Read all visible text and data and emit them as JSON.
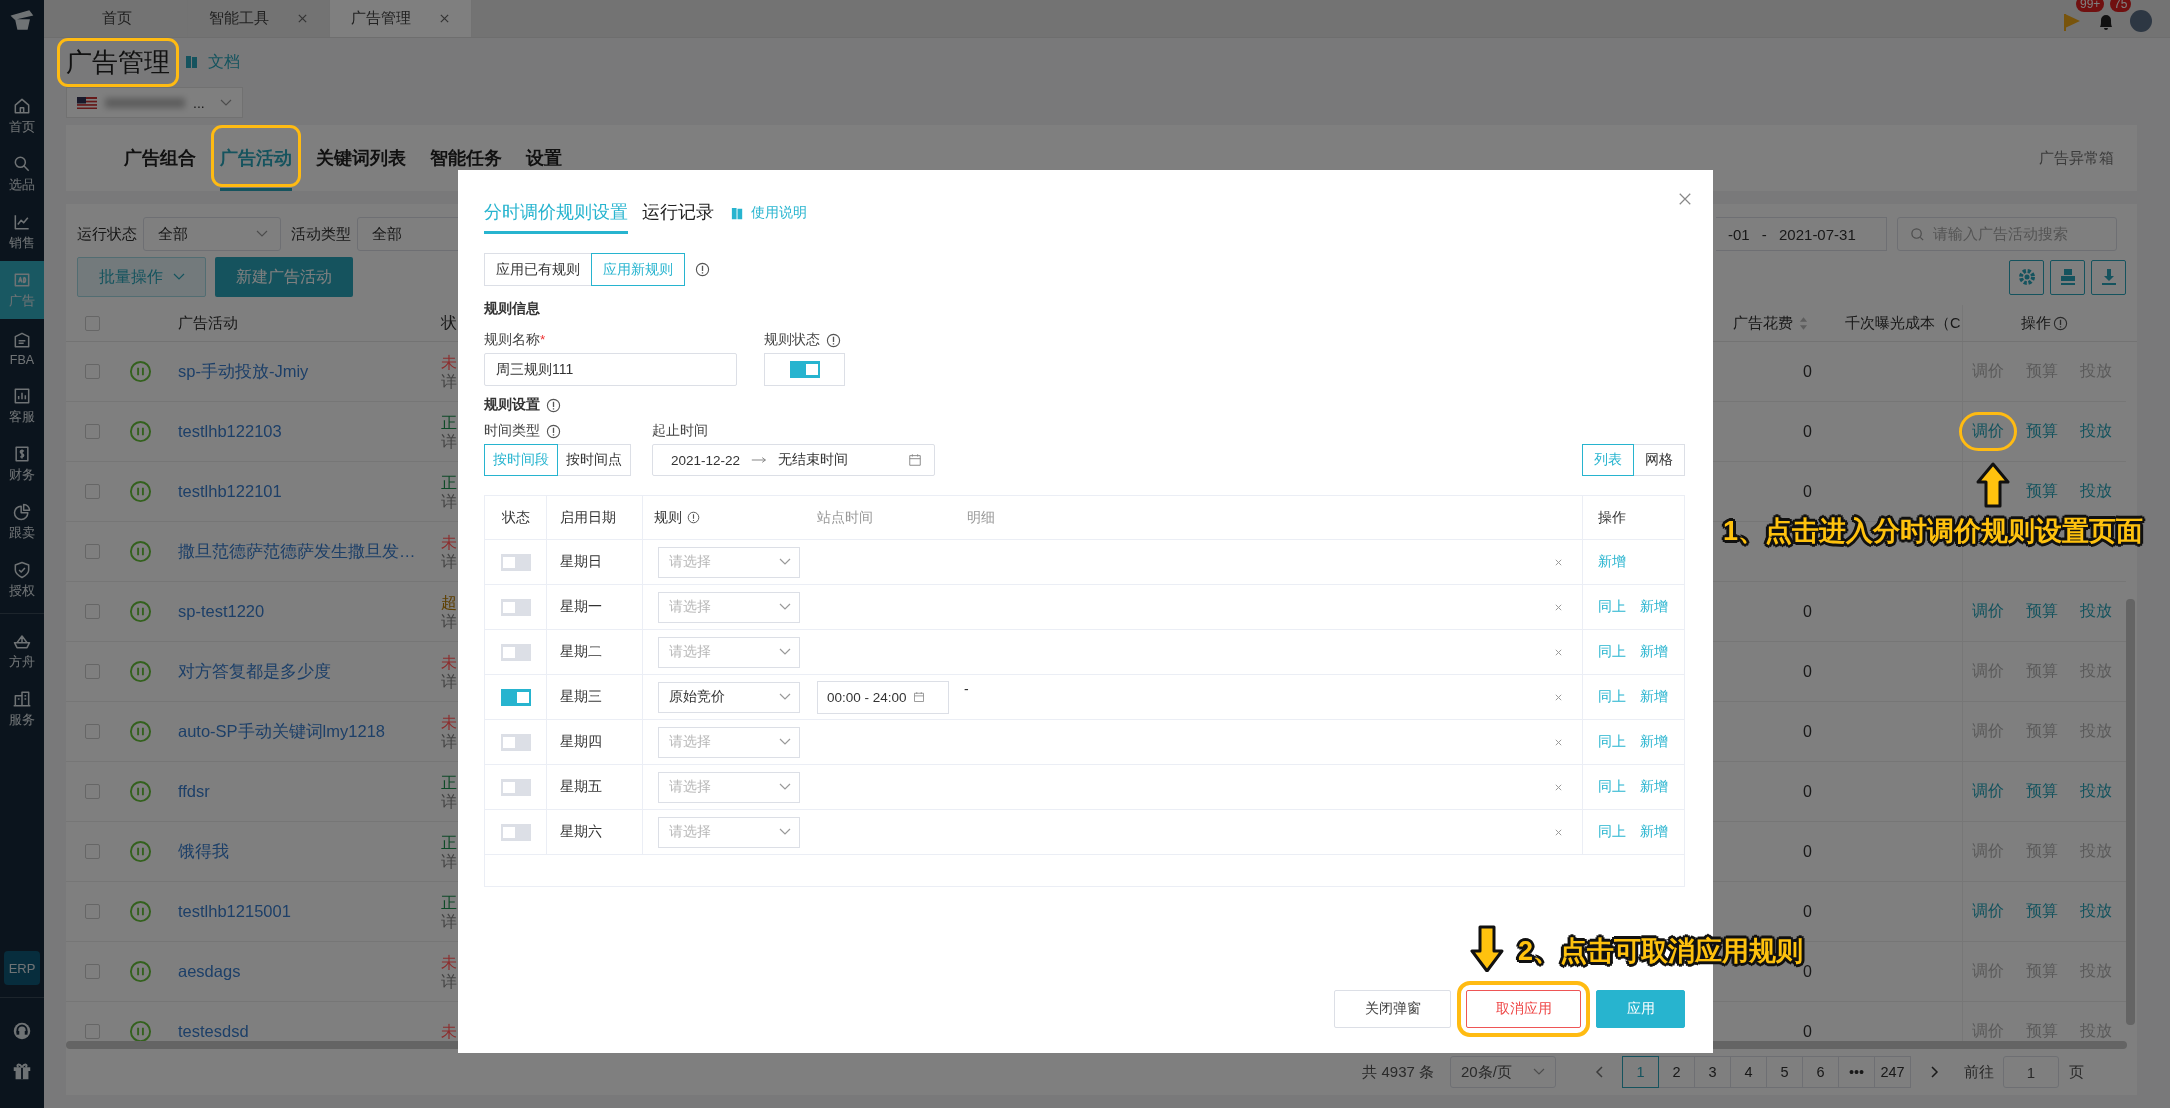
{
  "top_bar": {
    "tabs": [
      {
        "label": "首页",
        "closable": false,
        "selected": false
      },
      {
        "label": "智能工具",
        "closable": true,
        "selected": false
      },
      {
        "label": "广告管理",
        "closable": true,
        "selected": true
      }
    ],
    "flag_badge": "99+",
    "bell_badge": "75"
  },
  "sidebar": {
    "main": [
      {
        "label": "首页",
        "selected": false
      },
      {
        "label": "选品",
        "selected": false
      },
      {
        "label": "销售",
        "selected": false
      },
      {
        "label": "广告",
        "selected": true
      },
      {
        "label": "FBA",
        "selected": false
      },
      {
        "label": "客服",
        "selected": false
      },
      {
        "label": "财务",
        "selected": false
      },
      {
        "label": "跟卖",
        "selected": false
      },
      {
        "label": "授权",
        "selected": false
      }
    ],
    "more": [
      {
        "label": "方舟",
        "selected": false
      },
      {
        "label": "服务",
        "selected": false
      }
    ],
    "badge": "ERP"
  },
  "page": {
    "title": {
      "text": "广告管理",
      "highlighted": true
    },
    "doc_link": "文档",
    "store": {
      "text": "..."
    },
    "nav_tabs": [
      {
        "label": "广告组合",
        "selected": false,
        "highlighted": false
      },
      {
        "label": "广告活动",
        "selected": true,
        "highlighted": true
      },
      {
        "label": "关键词列表",
        "selected": false,
        "highlighted": false
      },
      {
        "label": "智能任务",
        "selected": false,
        "highlighted": false
      },
      {
        "label": "设置",
        "selected": false,
        "highlighted": false
      }
    ],
    "exception_box": "广告异常箱"
  },
  "filters": {
    "fields": [
      {
        "label": "运行状态",
        "value": "全部"
      },
      {
        "label": "活动类型",
        "value": "全部"
      }
    ],
    "date_range": "-01 - 2021-07-31",
    "search_placeholder": "请输入广告活动搜索",
    "batch_button": "批量操作",
    "create_button": "新建广告活动"
  },
  "campaigns": {
    "columns": {
      "name": "广告活动",
      "status": "状",
      "spend": "广告花费",
      "cpm": "千次曝光成本（C",
      "actions": "操作"
    },
    "all_checked": false,
    "rows": [
      {
        "name": "sp-手动投放-Jmiy",
        "checked": false,
        "status": {
          "text": "未",
          "color": "#8c2d2d"
        },
        "detail": "详",
        "spend": "0",
        "actions": [
          {
            "label": "调价",
            "disabled": true,
            "highlighted": false
          },
          {
            "label": "预算",
            "disabled": true,
            "highlighted": false
          },
          {
            "label": "投放",
            "disabled": true,
            "highlighted": false
          }
        ]
      },
      {
        "name": "testlhb122103",
        "checked": false,
        "status": {
          "text": "正",
          "color": "#0f4a28"
        },
        "detail": "详",
        "spend": "0",
        "actions": [
          {
            "label": "调价",
            "disabled": false,
            "highlighted": true
          },
          {
            "label": "预算",
            "disabled": false,
            "highlighted": false
          },
          {
            "label": "投放",
            "disabled": false,
            "highlighted": false
          }
        ]
      },
      {
        "name": "testlhb122101",
        "checked": false,
        "status": {
          "text": "正",
          "color": "#0f4a28"
        },
        "detail": "详",
        "spend": "0",
        "actions": [
          {
            "label": "预算",
            "disabled": false,
            "highlighted": false
          },
          {
            "label": "投放",
            "disabled": false,
            "highlighted": false
          }
        ]
      },
      {
        "name": "撒旦范德萨范德萨发生撒旦发…",
        "checked": false,
        "status": {
          "text": "未",
          "color": "#8c2d2d"
        },
        "detail": "详",
        "actions": []
      },
      {
        "name": "sp-test1220",
        "checked": false,
        "status": {
          "text": "超",
          "color": "#5e3f00"
        },
        "detail": "详",
        "spend": "0",
        "actions": [
          {
            "label": "调价",
            "disabled": false,
            "highlighted": false
          },
          {
            "label": "预算",
            "disabled": false,
            "highlighted": false
          },
          {
            "label": "投放",
            "disabled": false,
            "highlighted": false
          }
        ]
      },
      {
        "name": "对方答复都是多少度",
        "checked": false,
        "status": {
          "text": "未",
          "color": "#8c2d2d"
        },
        "detail": "详",
        "spend": "0",
        "actions": [
          {
            "label": "调价",
            "disabled": true,
            "highlighted": false
          },
          {
            "label": "预算",
            "disabled": true,
            "highlighted": false
          },
          {
            "label": "投放",
            "disabled": true,
            "highlighted": false
          }
        ]
      },
      {
        "name": "auto-SP手动关键词lmy1218",
        "checked": false,
        "status": {
          "text": "未",
          "color": "#8c2d2d"
        },
        "detail": "详",
        "spend": "0",
        "actions": [
          {
            "label": "调价",
            "disabled": true,
            "highlighted": false
          },
          {
            "label": "预算",
            "disabled": true,
            "highlighted": false
          },
          {
            "label": "投放",
            "disabled": true,
            "highlighted": false
          }
        ]
      },
      {
        "name": "ffdsr",
        "checked": false,
        "status": {
          "text": "正",
          "color": "#0f4a28"
        },
        "detail": "详",
        "spend": "0",
        "actions": [
          {
            "label": "调价",
            "disabled": false,
            "highlighted": false
          },
          {
            "label": "预算",
            "disabled": false,
            "highlighted": false
          },
          {
            "label": "投放",
            "disabled": false,
            "highlighted": false
          }
        ]
      },
      {
        "name": "饿得我",
        "checked": false,
        "status": {
          "text": "正",
          "color": "#0f4a28"
        },
        "detail": "详",
        "spend": "0",
        "actions": [
          {
            "label": "调价",
            "disabled": true,
            "highlighted": false
          },
          {
            "label": "预算",
            "disabled": true,
            "highlighted": false
          },
          {
            "label": "投放",
            "disabled": true,
            "highlighted": false
          }
        ]
      },
      {
        "name": "testlhb1215001",
        "checked": false,
        "status": {
          "text": "正",
          "color": "#0f4a28"
        },
        "detail": "详",
        "spend": "0",
        "actions": [
          {
            "label": "调价",
            "disabled": false,
            "highlighted": false
          },
          {
            "label": "预算",
            "disabled": false,
            "highlighted": false
          },
          {
            "label": "投放",
            "disabled": false,
            "highlighted": false
          }
        ]
      },
      {
        "name": "aesdags",
        "checked": false,
        "status": {
          "text": "未",
          "color": "#8c2d2d"
        },
        "detail": "详",
        "spend": "0",
        "actions": [
          {
            "label": "调价",
            "disabled": true,
            "highlighted": false
          },
          {
            "label": "预算",
            "disabled": true,
            "highlighted": false
          },
          {
            "label": "投放",
            "disabled": true,
            "highlighted": false
          }
        ]
      },
      {
        "name": "testesdsd",
        "checked": false,
        "status": {
          "text": "未",
          "color": "#8c2d2d"
        },
        "spend": "0",
        "actions": [
          {
            "label": "调价",
            "disabled": true,
            "highlighted": false
          },
          {
            "label": "预算",
            "disabled": true,
            "highlighted": false
          },
          {
            "label": "投放",
            "disabled": true,
            "highlighted": false
          }
        ]
      }
    ]
  },
  "pagination": {
    "total": "共 4937 条",
    "page_size": "20条/页",
    "pages": [
      {
        "label": "1",
        "selected": true
      },
      {
        "label": "2",
        "selected": false
      },
      {
        "label": "3",
        "selected": false
      },
      {
        "label": "4",
        "selected": false
      },
      {
        "label": "5",
        "selected": false
      },
      {
        "label": "6",
        "selected": false
      },
      {
        "label": "•••",
        "selected": false
      },
      {
        "label": "247",
        "selected": false
      }
    ],
    "goto_label": "前往",
    "goto_value": "1",
    "goto_unit": "页"
  },
  "modal": {
    "tabs": [
      {
        "label": "分时调价规则设置",
        "selected": true
      },
      {
        "label": "运行记录",
        "selected": false
      }
    ],
    "help_link": "使用说明",
    "apply_mode": [
      {
        "label": "应用已有规则",
        "selected": false
      },
      {
        "label": "应用新规则",
        "selected": true
      }
    ],
    "rule_info_title": "规则信息",
    "rule_name": {
      "label": "规则名称",
      "required_mark": "*",
      "value": "周三规则111"
    },
    "rule_status": {
      "label": "规则状态",
      "on": true
    },
    "rule_settings_title": "规则设置",
    "time_type": {
      "label": "时间类型",
      "options": [
        {
          "label": "按时间段",
          "selected": true
        },
        {
          "label": "按时间点",
          "selected": false
        }
      ]
    },
    "period": {
      "label": "起止时间",
      "start": "2021-12-22",
      "end": "无结束时间"
    },
    "view_mode": [
      {
        "label": "列表",
        "selected": true
      },
      {
        "label": "网格",
        "selected": false
      }
    ],
    "schedule": {
      "columns": {
        "status": "状态",
        "day": "启用日期",
        "rule": "规则",
        "site_time": "站点时间",
        "detail": "明细",
        "actions": "操作"
      },
      "rows": [
        {
          "on": false,
          "day": "星期日",
          "rule": {
            "placeholder": "请选择"
          },
          "actions": [
            "新增"
          ]
        },
        {
          "on": false,
          "day": "星期一",
          "rule": {
            "placeholder": "请选择"
          },
          "actions": [
            "同上",
            "新增"
          ]
        },
        {
          "on": false,
          "day": "星期二",
          "rule": {
            "placeholder": "请选择"
          },
          "actions": [
            "同上",
            "新增"
          ]
        },
        {
          "on": true,
          "day": "星期三",
          "rule": {
            "value": "原始竞价"
          },
          "time": "00:00 - 24:00",
          "detail": "-",
          "actions": [
            "同上",
            "新增"
          ]
        },
        {
          "on": false,
          "day": "星期四",
          "rule": {
            "placeholder": "请选择"
          },
          "actions": [
            "同上",
            "新增"
          ]
        },
        {
          "on": false,
          "day": "星期五",
          "rule": {
            "placeholder": "请选择"
          },
          "actions": [
            "同上",
            "新增"
          ]
        },
        {
          "on": false,
          "day": "星期六",
          "rule": {
            "placeholder": "请选择"
          },
          "actions": [
            "同上",
            "新增"
          ]
        }
      ]
    },
    "buttons": [
      {
        "label": "关闭弹窗",
        "kind": "default",
        "highlighted": false
      },
      {
        "label": "取消应用",
        "kind": "danger",
        "highlighted": true
      },
      {
        "label": "应用",
        "kind": "primary",
        "highlighted": false
      }
    ]
  },
  "annotations": [
    {
      "text": "1、点击进入分时调价规则设置页面",
      "kind": "up"
    },
    {
      "text": "2、点击可取消应用规则",
      "kind": "down"
    }
  ]
}
